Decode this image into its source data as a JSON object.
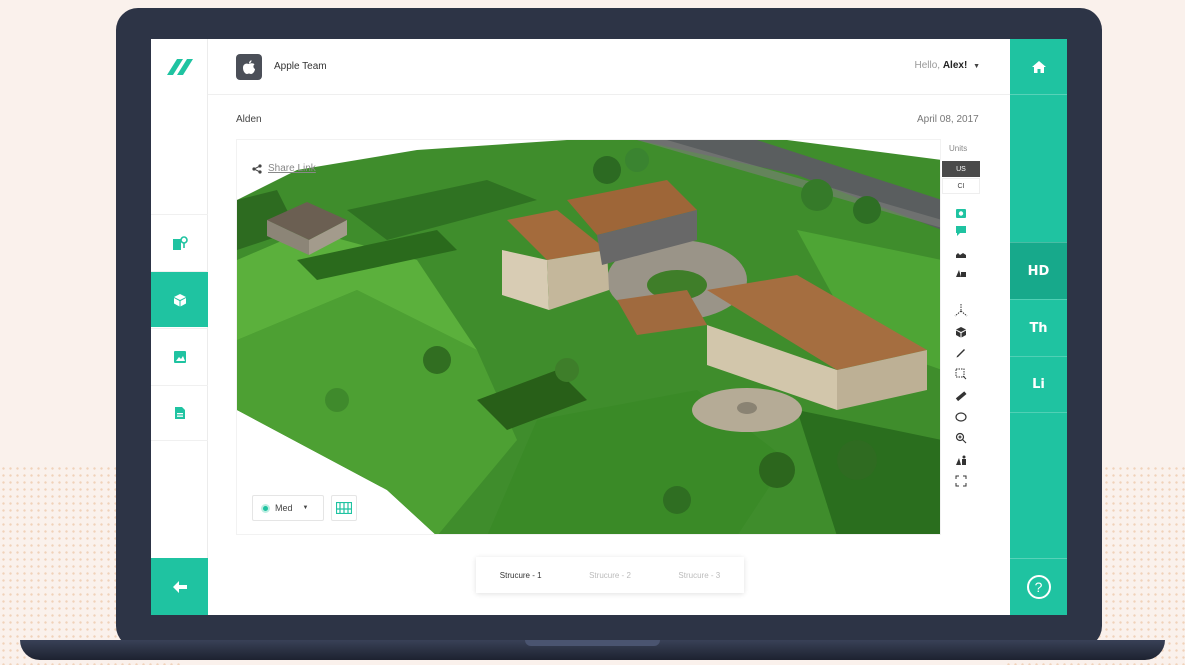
{
  "header": {
    "team_name": "Apple Team",
    "greeting_prefix": "Hello, ",
    "user_name": "Alex!"
  },
  "project": {
    "name": "Alden",
    "date": "April 08, 2017"
  },
  "viewer": {
    "share_link": "Share Link",
    "quality_value": "Med"
  },
  "units": {
    "label": "Units",
    "options": [
      "US",
      "CI"
    ],
    "selected": "US"
  },
  "right_sidebar": {
    "items": [
      "HD",
      "Th",
      "Li"
    ],
    "active": "HD",
    "help": "?"
  },
  "structure_tabs": [
    "Strucure - 1",
    "Strucure - 2",
    "Strucure - 3"
  ],
  "active_structure": "Strucure - 1",
  "colors": {
    "accent": "#1fc3a1",
    "accent_dark": "#17a98b",
    "laptop_frame": "#2d3446"
  },
  "icons": {
    "left_sidebar": [
      "map-pin-icon",
      "cube-icon",
      "image-icon",
      "document-icon"
    ],
    "back": "arrow-left-icon",
    "home": "home-icon"
  }
}
